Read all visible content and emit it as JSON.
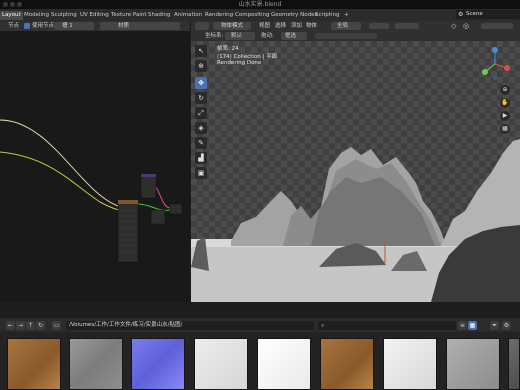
{
  "window": {
    "title": "山水实景.blend"
  },
  "workspaces": [
    "Layout",
    "Modeling",
    "Sculpting",
    "UV Editing",
    "Texture Paint",
    "Shading",
    "Animation",
    "Rendering",
    "Compositing",
    "Geometry Nodes",
    "Scripting"
  ],
  "add_tab": "+",
  "scene": {
    "label": "Scene"
  },
  "node_editor": {
    "header": {
      "node": "节点",
      "use_nodes": "使用节点",
      "slot": "槽 1",
      "material": "材质"
    }
  },
  "viewport": {
    "header": {
      "mode": "物体模式",
      "view": "视图",
      "select": "选择",
      "add": "添加",
      "object": "物体",
      "transform_global": "全局"
    },
    "header2": {
      "coord": "坐标系:",
      "coord_value": "默认",
      "pivot": "拖动:",
      "pivot_value": "框选"
    },
    "info": {
      "frame": "帧率: 24",
      "collection": "(174) Collection | 平面",
      "status": "Rendering Done"
    }
  },
  "file_browser": {
    "path": "/Volumes/工作/工作文件/练习/实景山水/贴图/",
    "search_placeholder": ""
  },
  "colors": {
    "accent": "#4772b3",
    "link_yellow": "#c8c83c",
    "link_green": "#3cc83c",
    "link_pink": "#e0508a"
  }
}
